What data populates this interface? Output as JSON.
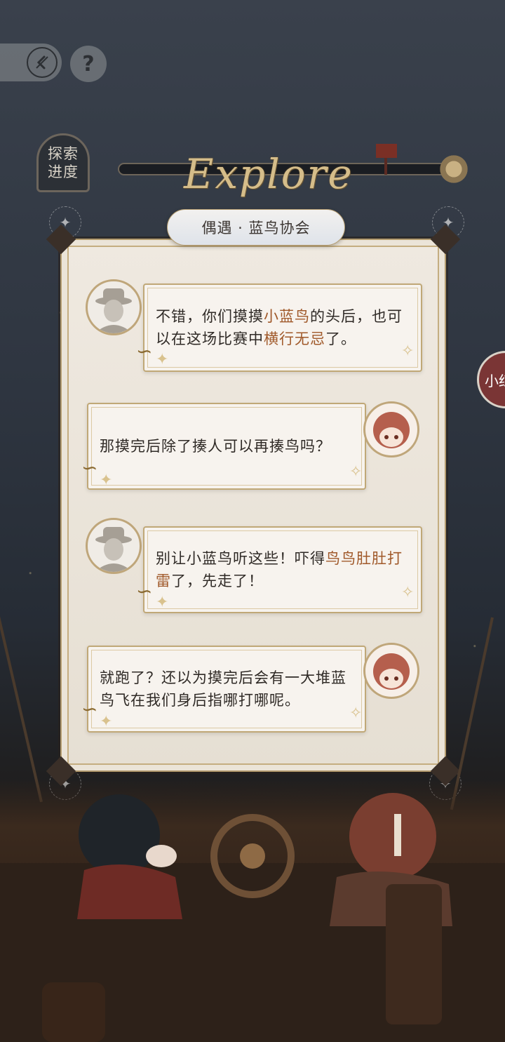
{
  "header": {
    "back_icon": "back-arrow-icon",
    "help_label": "?"
  },
  "progress": {
    "label_line1": "探索",
    "label_line2": "进度"
  },
  "title": {
    "logo_text": "Explore",
    "subtitle": "偶遇 · 蓝鸟协会"
  },
  "side_tab": {
    "label": "小红"
  },
  "dialogue": [
    {
      "speaker": "hat-man",
      "side": "left",
      "parts": [
        "不错，你们摸摸",
        "小蓝鸟",
        "的头后，也可以在这场比赛中",
        "横行无忌",
        "了。"
      ]
    },
    {
      "speaker": "girl",
      "side": "right",
      "parts": [
        "那摸完后除了揍人可以再揍鸟吗？"
      ]
    },
    {
      "speaker": "hat-man",
      "side": "left",
      "parts": [
        "别让小蓝鸟听这些！吓得",
        "鸟鸟肚肚打雷",
        "了，先走了！"
      ]
    },
    {
      "speaker": "girl",
      "side": "right",
      "parts": [
        "就跑了？还以为摸完后会有一大堆蓝鸟飞在我们身后指哪打哪呢。"
      ]
    }
  ],
  "colors": {
    "highlight": "#a0592a",
    "parchment": "#efe9e0",
    "gold_border": "#c0a877"
  }
}
